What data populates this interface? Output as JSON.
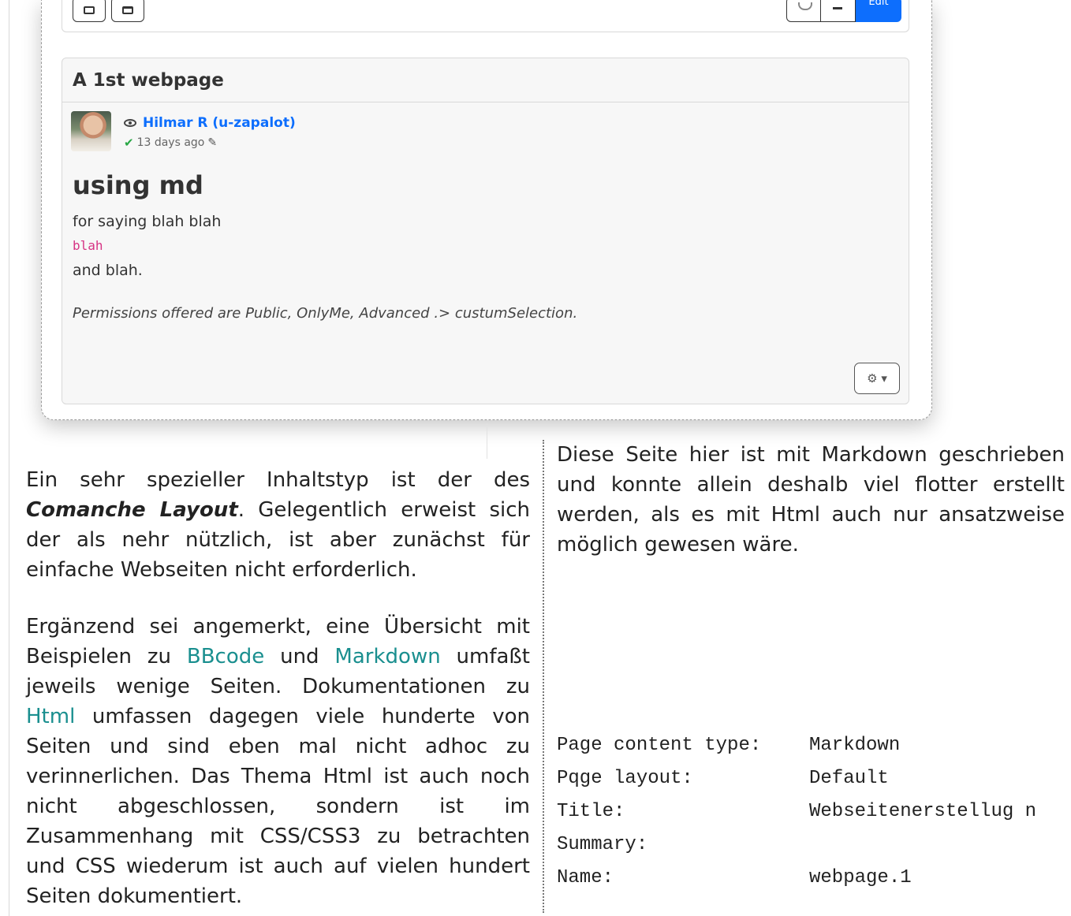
{
  "toolbar": {
    "edit_label": "Edit"
  },
  "post": {
    "title": "A 1st webpage",
    "author": "Hilmar R (u-zapalot)",
    "time": "13 days ago",
    "heading": "using md",
    "line1": "for saying blah blah",
    "code": "blah",
    "line3": "and blah.",
    "permissions": "Permissions offered are Public, OnlyMe, Advanced .> custumSelection."
  },
  "article": {
    "p1_a": "Ein sehr spezieller Inhaltstyp ist der des ",
    "p1_em": "Comanche Layout",
    "p1_b": ". Gelegentlich erweist sich der als nehr nützlich, ist aber zunächst für einfache Webseiten nicht erforderlich.",
    "p2_a": "Ergänzend sei angemerkt, eine Übersicht mit Beispielen zu ",
    "link_bbcode": "BBcode",
    "p2_b": " und ",
    "link_markdown": "Markdown",
    "p2_c": " umfaßt jeweils wenige Seiten. Dokumentationen zu ",
    "link_html": "Html",
    "p2_d": " umfassen dagegen viele hunderte von Seiten und sind eben mal nicht adhoc zu verinnerlichen. Das Thema Html ist auch noch nicht abgeschlossen, sondern ist im Zusammenhang mit CSS/CSS3 zu betrachten und CSS wiederum ist auch auf vielen hundert Seiten dokumentiert.",
    "p3": "Diese Seite hier ist mit Markdown geschrieben und konnte allein deshalb viel flotter erstellt werden, als es mit Html auch nur ansatzweise möglich gewesen wäre."
  },
  "meta_block": [
    {
      "key": "Page content type:",
      "value": "Markdown"
    },
    {
      "key": "Pqge layout:",
      "value": "Default"
    },
    {
      "key": "Title:",
      "value": "Webseitenerstellug n"
    },
    {
      "key": "Summary:",
      "value": ""
    },
    {
      "key": "Name:",
      "value": "webpage.1"
    }
  ]
}
